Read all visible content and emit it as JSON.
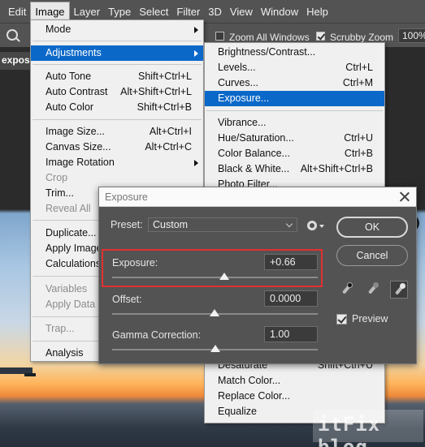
{
  "menubar": [
    "Edit",
    "Image",
    "Layer",
    "Type",
    "Select",
    "Filter",
    "3D",
    "View",
    "Window",
    "Help"
  ],
  "optbar": {
    "zoom_all_windows": "Zoom All Windows",
    "scrubby_zoom": "Scrubby Zoom",
    "zoom_pct": "100%"
  },
  "doc_tab": "exposu",
  "image_menu": {
    "mode": "Mode",
    "adjustments": "Adjustments",
    "auto_tone": {
      "label": "Auto Tone",
      "shortcut": "Shift+Ctrl+L"
    },
    "auto_contrast": {
      "label": "Auto Contrast",
      "shortcut": "Alt+Shift+Ctrl+L"
    },
    "auto_color": {
      "label": "Auto Color",
      "shortcut": "Shift+Ctrl+B"
    },
    "image_size": {
      "label": "Image Size...",
      "shortcut": "Alt+Ctrl+I"
    },
    "canvas_size": {
      "label": "Canvas Size...",
      "shortcut": "Alt+Ctrl+C"
    },
    "image_rotation": "Image Rotation",
    "crop": "Crop",
    "trim": "Trim...",
    "reveal_all": "Reveal All",
    "duplicate": "Duplicate...",
    "apply_image": "Apply Image...",
    "calculations": "Calculations...",
    "variables": "Variables",
    "apply_data": "Apply Data Set...",
    "trap": "Trap...",
    "analysis": "Analysis"
  },
  "adj_menu": {
    "brightness": "Brightness/Contrast...",
    "levels": {
      "label": "Levels...",
      "shortcut": "Ctrl+L"
    },
    "curves": {
      "label": "Curves...",
      "shortcut": "Ctrl+M"
    },
    "exposure": "Exposure...",
    "vibrance": "Vibrance...",
    "hue_sat": {
      "label": "Hue/Saturation...",
      "shortcut": "Ctrl+U"
    },
    "color_balance": {
      "label": "Color Balance...",
      "shortcut": "Ctrl+B"
    },
    "black_white": {
      "label": "Black & White...",
      "shortcut": "Alt+Shift+Ctrl+B"
    },
    "photo_filter": "Photo Filter...",
    "desaturate": {
      "label": "Desaturate",
      "shortcut": "Shift+Ctrl+U"
    },
    "match_color": "Match Color...",
    "replace_color": "Replace Color...",
    "equalize": "Equalize"
  },
  "dialog": {
    "title": "Exposure",
    "preset_label": "Preset:",
    "preset_value": "Custom",
    "exposure_label": "Exposure:",
    "exposure_value": "+0.66",
    "offset_label": "Offset:",
    "offset_value": "0.0000",
    "gamma_label": "Gamma Correction:",
    "gamma_value": "1.00",
    "ok": "OK",
    "cancel": "Cancel",
    "preview": "Preview",
    "preview_checked": true,
    "eyedroppers": [
      "black-point-eyedropper-icon",
      "gray-point-eyedropper-icon",
      "white-point-eyedropper-icon"
    ]
  },
  "watermark": "itFix blog"
}
